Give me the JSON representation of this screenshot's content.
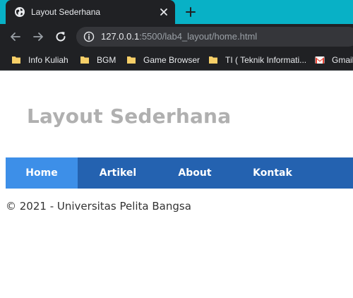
{
  "browser": {
    "tab_title": "Layout Sederhana",
    "url_host": "127.0.0.1",
    "url_rest": ":5500/lab4_layout/home.html",
    "bookmarks": [
      {
        "label": "Info Kuliah",
        "icon": "folder-icon"
      },
      {
        "label": "BGM",
        "icon": "folder-icon"
      },
      {
        "label": "Game Browser",
        "icon": "folder-icon"
      },
      {
        "label": "TI ( Teknik Informati...",
        "icon": "folder-icon"
      },
      {
        "label": "Gmail",
        "icon": "gmail-icon"
      }
    ]
  },
  "page": {
    "title": "Layout Sederhana",
    "nav": [
      {
        "label": "Home",
        "active": true
      },
      {
        "label": "Artikel",
        "active": false
      },
      {
        "label": "About",
        "active": false
      },
      {
        "label": "Kontak",
        "active": false
      }
    ],
    "footer": "© 2021 - Universitas Pelita Bangsa"
  },
  "colors": {
    "tabstrip": "#08b1c6",
    "chrome_dark": "#202124",
    "nav_bg": "#2462b0",
    "nav_active": "#3d8fe8",
    "title_gray": "#b0b0b0"
  }
}
